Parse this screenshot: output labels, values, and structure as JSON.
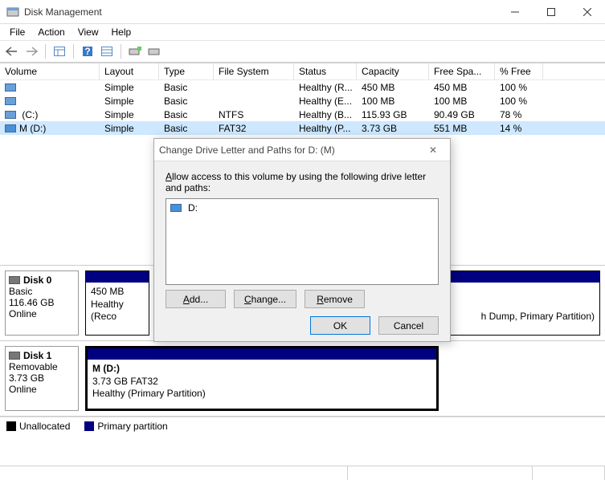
{
  "window": {
    "title": "Disk Management"
  },
  "menu": {
    "file": "File",
    "action": "Action",
    "view": "View",
    "help": "Help"
  },
  "columns": {
    "volume": "Volume",
    "layout": "Layout",
    "type": "Type",
    "fs": "File System",
    "status": "Status",
    "capacity": "Capacity",
    "free": "Free Spa...",
    "pct": "% Free"
  },
  "volumes": [
    {
      "name": "",
      "layout": "Simple",
      "type": "Basic",
      "fs": "",
      "status": "Healthy (R...",
      "capacity": "450 MB",
      "free": "450 MB",
      "pct": "100 %"
    },
    {
      "name": "",
      "layout": "Simple",
      "type": "Basic",
      "fs": "",
      "status": "Healthy (E...",
      "capacity": "100 MB",
      "free": "100 MB",
      "pct": "100 %"
    },
    {
      "name": " (C:)",
      "layout": "Simple",
      "type": "Basic",
      "fs": "NTFS",
      "status": "Healthy (B...",
      "capacity": "115.93 GB",
      "free": "90.49 GB",
      "pct": "78 %"
    },
    {
      "name": "M (D:)",
      "layout": "Simple",
      "type": "Basic",
      "fs": "FAT32",
      "status": "Healthy (P...",
      "capacity": "3.73 GB",
      "free": "551 MB",
      "pct": "14 %"
    }
  ],
  "disks": [
    {
      "title": "Disk 0",
      "type": "Basic",
      "size": "116.46 GB",
      "status": "Online",
      "partitions": [
        {
          "name": "",
          "size": "450 MB",
          "detail": "Healthy (Reco",
          "right_detail": "h Dump, Primary Partition)"
        }
      ]
    },
    {
      "title": "Disk 1",
      "type": "Removable",
      "size": "3.73 GB",
      "status": "Online",
      "partitions": [
        {
          "name": "M  (D:)",
          "size": "3.73 GB FAT32",
          "detail": "Healthy (Primary Partition)"
        }
      ]
    }
  ],
  "legend": {
    "unallocated": "Unallocated",
    "primary": "Primary partition"
  },
  "dialog": {
    "title": "Change Drive Letter and Paths for D: (M)",
    "instruction_pre": "A",
    "instruction": "llow access to this volume by using the following drive letter and paths:",
    "entry": "D:",
    "add": "Add...",
    "change": "Change...",
    "remove": "Remove",
    "ok": "OK",
    "cancel": "Cancel"
  }
}
